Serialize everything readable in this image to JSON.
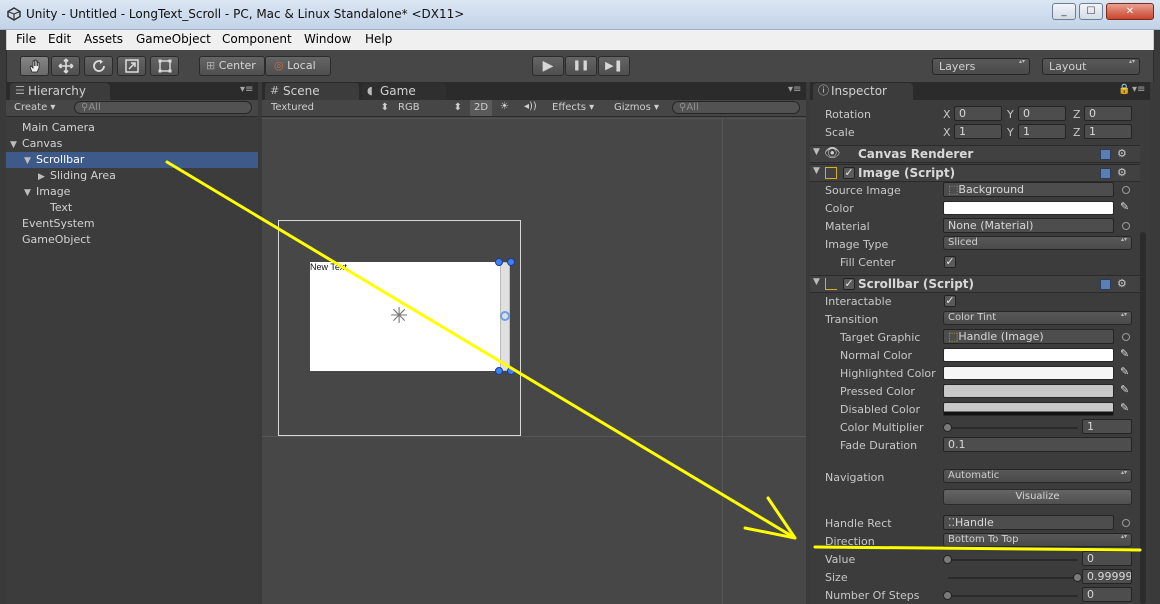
{
  "window": {
    "title": "Unity - Untitled - LongText_Scroll - PC, Mac & Linux Standalone* <DX11>",
    "minimize": "_",
    "maximize": "☐",
    "close": "✕"
  },
  "menu": [
    "File",
    "Edit",
    "Assets",
    "GameObject",
    "Component",
    "Window",
    "Help"
  ],
  "toolbar": {
    "tools": [
      "hand-tool-icon",
      "move-tool-icon",
      "rotate-tool-icon",
      "scale-tool-icon",
      "rect-tool-icon"
    ],
    "pivot": "Center",
    "space": "Local",
    "play": "▶",
    "pause": "❚❚",
    "step": "▶❚",
    "layers": "Layers",
    "layout": "Layout"
  },
  "hierarchy": {
    "tab": "Hierarchy",
    "create": "Create",
    "search_placeholder": "All",
    "items": [
      {
        "label": "Main Camera",
        "indent": 0,
        "expander": "",
        "selected": false
      },
      {
        "label": "Canvas",
        "indent": 0,
        "expander": "▼",
        "selected": false
      },
      {
        "label": "Scrollbar",
        "indent": 1,
        "expander": "▼",
        "selected": true
      },
      {
        "label": "Sliding Area",
        "indent": 2,
        "expander": "▶",
        "selected": false
      },
      {
        "label": "Image",
        "indent": 1,
        "expander": "▼",
        "selected": false
      },
      {
        "label": "Text",
        "indent": 2,
        "expander": "",
        "selected": false
      },
      {
        "label": "EventSystem",
        "indent": 0,
        "expander": "",
        "selected": false
      },
      {
        "label": "GameObject",
        "indent": 0,
        "expander": "",
        "selected": false
      }
    ]
  },
  "scene": {
    "tab_scene": "Scene",
    "tab_game": "Game",
    "shading": "Textured",
    "render_mode": "RGB",
    "mode_2d": "2D",
    "effects": "Effects",
    "gizmos": "Gizmos",
    "search_placeholder": "All",
    "text_object": "New Text"
  },
  "inspector": {
    "tab": "Inspector",
    "rotation": {
      "label": "Rotation",
      "x": "0",
      "y": "0",
      "z": "0"
    },
    "scale": {
      "label": "Scale",
      "x": "1",
      "y": "1",
      "z": "1"
    },
    "axis": [
      "X",
      "Y",
      "Z"
    ],
    "canvas_renderer": "Canvas Renderer",
    "image_script": {
      "title": "Image (Script)",
      "source_image_label": "Source Image",
      "source_image": "Background",
      "color_label": "Color",
      "material_label": "Material",
      "material": "None (Material)",
      "image_type_label": "Image Type",
      "image_type": "Sliced",
      "fill_center_label": "Fill Center"
    },
    "scrollbar_script": {
      "title": "Scrollbar (Script)",
      "interactable_label": "Interactable",
      "transition_label": "Transition",
      "transition": "Color Tint",
      "target_graphic_label": "Target Graphic",
      "target_graphic": "Handle (Image)",
      "normal_color_label": "Normal Color",
      "highlighted_color_label": "Highlighted Color",
      "pressed_color_label": "Pressed Color",
      "disabled_color_label": "Disabled Color",
      "color_multiplier_label": "Color Multiplier",
      "color_multiplier": "1",
      "color_multiplier_value": 1,
      "fade_duration_label": "Fade Duration",
      "fade_duration": "0.1",
      "navigation_label": "Navigation",
      "navigation": "Automatic",
      "visualize": "Visualize",
      "handle_rect_label": "Handle Rect",
      "handle_rect": "Handle",
      "direction_label": "Direction",
      "direction": "Bottom To Top",
      "value_label": "Value",
      "value": "0",
      "value_level": 0,
      "size_label": "Size",
      "size": "0.99999",
      "size_level": 0.99999,
      "steps_label": "Number Of Steps",
      "steps": "0",
      "steps_level": 0
    }
  },
  "colors": {
    "annotation": "#ffff00",
    "selection": "#3d5a8a",
    "normal_color": "#ffffff",
    "highlighted_color": "#f5f5f5",
    "pressed_color": "#c8c8c8",
    "disabled_color": "#c8c8c8"
  }
}
